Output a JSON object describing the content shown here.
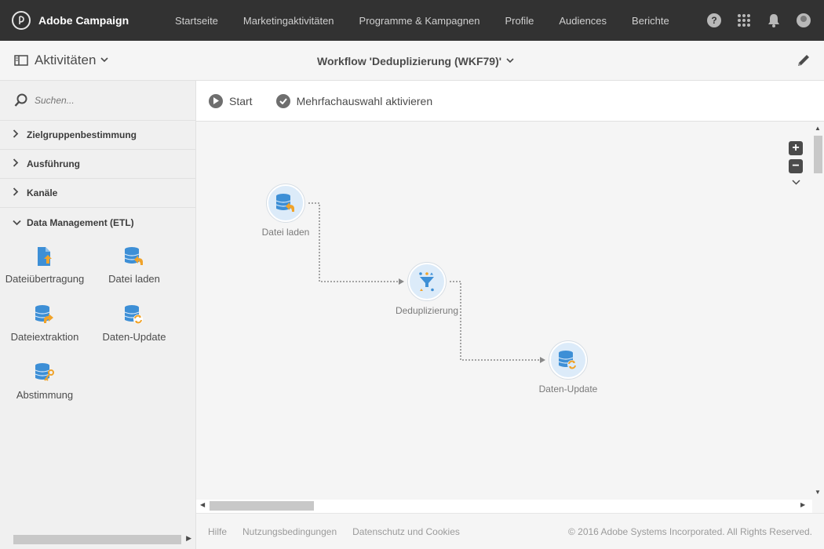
{
  "app": {
    "name": "Adobe Campaign",
    "nav": [
      "Startseite",
      "Marketingaktivitäten",
      "Programme & Kampagnen",
      "Profile",
      "Audiences",
      "Berichte"
    ],
    "help_glyph": "?"
  },
  "subheader": {
    "activities_label": "Aktivitäten",
    "workflow_title": "Workflow 'Deduplizierung (WKF79)'"
  },
  "sidebar": {
    "search_placeholder": "Suchen...",
    "categories": [
      {
        "label": "Zielgruppenbestimmung",
        "expanded": false
      },
      {
        "label": "Ausführung",
        "expanded": false
      },
      {
        "label": "Kanäle",
        "expanded": false
      },
      {
        "label": "Data Management (ETL)",
        "expanded": true
      }
    ],
    "activities": [
      {
        "label": "Dateiübertragung",
        "icon": "file-transfer-icon"
      },
      {
        "label": "Datei laden",
        "icon": "load-file-icon"
      },
      {
        "label": "Dateiextraktion",
        "icon": "extract-file-icon"
      },
      {
        "label": "Daten-Update",
        "icon": "update-data-icon"
      },
      {
        "label": "Abstimmung",
        "icon": "reconciliation-icon"
      }
    ]
  },
  "toolbar": {
    "start_label": "Start",
    "multiselect_label": "Mehrfachauswahl aktivieren"
  },
  "canvas": {
    "nodes": [
      {
        "label": "Datei laden",
        "icon": "load-file-icon"
      },
      {
        "label": "Deduplizierung",
        "icon": "funnel-icon"
      },
      {
        "label": "Daten-Update",
        "icon": "update-data-icon"
      }
    ],
    "zoom_in": "+",
    "zoom_out": "−"
  },
  "footer": {
    "links": [
      "Hilfe",
      "Nutzungsbedingungen",
      "Datenschutz und Cookies"
    ],
    "copyright": "© 2016 Adobe Systems Incorporated. All Rights Reserved."
  },
  "colors": {
    "topbar": "#323232",
    "node_bg": "#dcebf9",
    "db_blue": "#3d8fd6",
    "accent_orange": "#f0a32a"
  }
}
